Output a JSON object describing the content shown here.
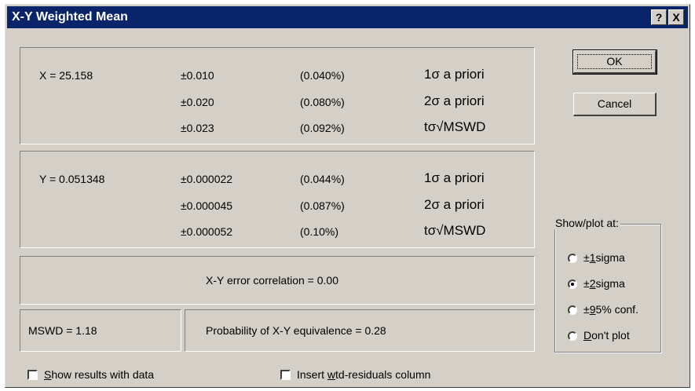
{
  "window": {
    "title": "X-Y Weighted Mean",
    "help_btn": "?",
    "close_btn": "X"
  },
  "x_panel": {
    "label": "X = 25.158",
    "rows": [
      {
        "err": "±0.010",
        "pct": "(0.040%)",
        "desc": "1σ a priori"
      },
      {
        "err": "±0.020",
        "pct": "(0.080%)",
        "desc": "2σ a priori"
      },
      {
        "err": "±0.023",
        "pct": "(0.092%)",
        "desc": "tσ√MSWD"
      }
    ]
  },
  "y_panel": {
    "label": "Y = 0.051348",
    "rows": [
      {
        "err": "±0.000022",
        "pct": "(0.044%)",
        "desc": "1σ a priori"
      },
      {
        "err": "±0.000045",
        "pct": "(0.087%)",
        "desc": "2σ a priori"
      },
      {
        "err": "±0.000052",
        "pct": "(0.10%)",
        "desc": "tσ√MSWD"
      }
    ]
  },
  "correlation": "X-Y error correlation = 0.00",
  "mswd": "MSWD = 1.18",
  "probability": "Probability of X-Y equivalence = 0.28",
  "buttons": {
    "ok": "OK",
    "cancel": "Cancel"
  },
  "show_plot": {
    "label": "Show/plot at:",
    "options": [
      {
        "pre": "±",
        "ul": "1",
        "post": "sigma",
        "selected": false
      },
      {
        "pre": "±",
        "ul": "2",
        "post": "sigma",
        "selected": true
      },
      {
        "pre": "±",
        "ul": "9",
        "post": "5% conf.",
        "selected": false
      },
      {
        "pre": "",
        "ul": "D",
        "post": "on't plot",
        "selected": false
      }
    ]
  },
  "checkboxes": [
    {
      "ul": "S",
      "post": "how results with data",
      "checked": false
    },
    {
      "pre": "Insert ",
      "ul": "w",
      "post": "td-residuals column",
      "checked": false
    }
  ]
}
